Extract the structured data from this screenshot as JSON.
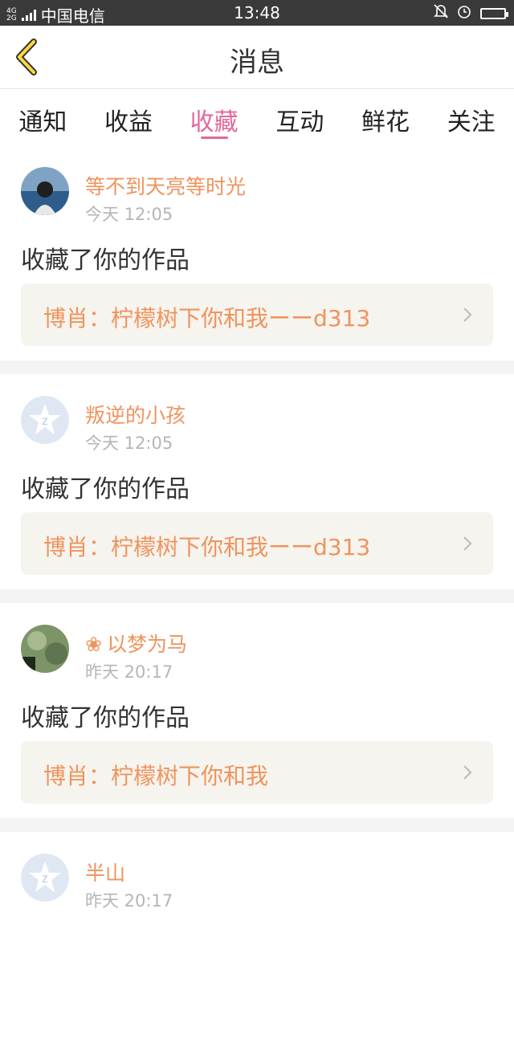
{
  "statusbar": {
    "network": [
      "4G",
      "2G"
    ],
    "carrier": "中国电信",
    "time": "13:48"
  },
  "header": {
    "title": "消息"
  },
  "tabs": [
    {
      "label": "通知",
      "active": false
    },
    {
      "label": "收益",
      "active": false
    },
    {
      "label": "收藏",
      "active": true
    },
    {
      "label": "互动",
      "active": false
    },
    {
      "label": "鲜花",
      "active": false
    },
    {
      "label": "关注",
      "active": false
    }
  ],
  "items": [
    {
      "user": "等不到天亮等时光",
      "time": "今天 12:05",
      "action": "收藏了你的作品",
      "work": "博肖：柠檬树下你和我ーーd313",
      "avatar": "photo-avatar"
    },
    {
      "user": "叛逆的小孩",
      "time": "今天 12:05",
      "action": "收藏了你的作品",
      "work": "博肖：柠檬树下你和我ーーd313",
      "avatar": "default-avatar"
    },
    {
      "user": "以梦为马",
      "time": "昨天 20:17",
      "action": "收藏了你的作品",
      "work": "博肖：柠檬树下你和我",
      "avatar": "photo-avatar"
    },
    {
      "user": "半山",
      "time": "昨天 20:17",
      "action": "",
      "work": "",
      "avatar": "default-avatar"
    }
  ],
  "colors": {
    "accent": "#e4679b",
    "name": "#f0935e",
    "card": "#f6f4ee"
  }
}
